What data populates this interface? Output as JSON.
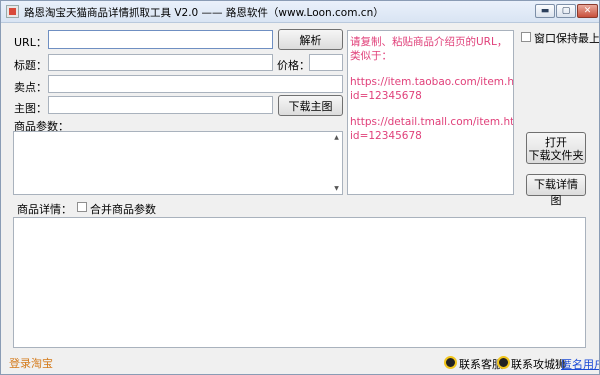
{
  "window": {
    "title": "路恩淘宝天猫商品详情抓取工具 V2.0 —— 路恩软件（www.Loon.com.cn）"
  },
  "window_controls": {
    "minimize": "▬",
    "maximize": "▢",
    "close": "✕"
  },
  "form": {
    "url_label": "URL：",
    "url_value": "",
    "parse_button": "解析",
    "title_label": "标题：",
    "title_value": "",
    "price_label": "价格：",
    "price_value": "",
    "selling_label": "卖点：",
    "selling_value": "",
    "main_image_label": "主图：",
    "main_image_value": "",
    "download_main_button": "下载主图",
    "params_label": "商品参数：",
    "params_value": ""
  },
  "hint": {
    "lines": [
      "请复制、粘贴商品介绍页的URL，类似于：",
      "https://item.taobao.com/item.htm?",
      "id=12345678",
      "https://detail.tmall.com/item.htm?",
      "id=12345678"
    ]
  },
  "right_panel": {
    "keep_on_top_label": "窗口保持最上",
    "keep_on_top_checked": false,
    "open_folder_line1": "打开",
    "open_folder_line2": "下载文件夹",
    "download_detail_button": "下载详情图"
  },
  "detail": {
    "label": "商品详情：",
    "merge_params_label": "合并商品参数",
    "merge_params_checked": false,
    "content": ""
  },
  "status": {
    "login_taobao": "登录淘宝",
    "contact_support": "联系客服",
    "contact_author": "联系攻城狮",
    "anonymous_user": "匿名用户"
  }
}
